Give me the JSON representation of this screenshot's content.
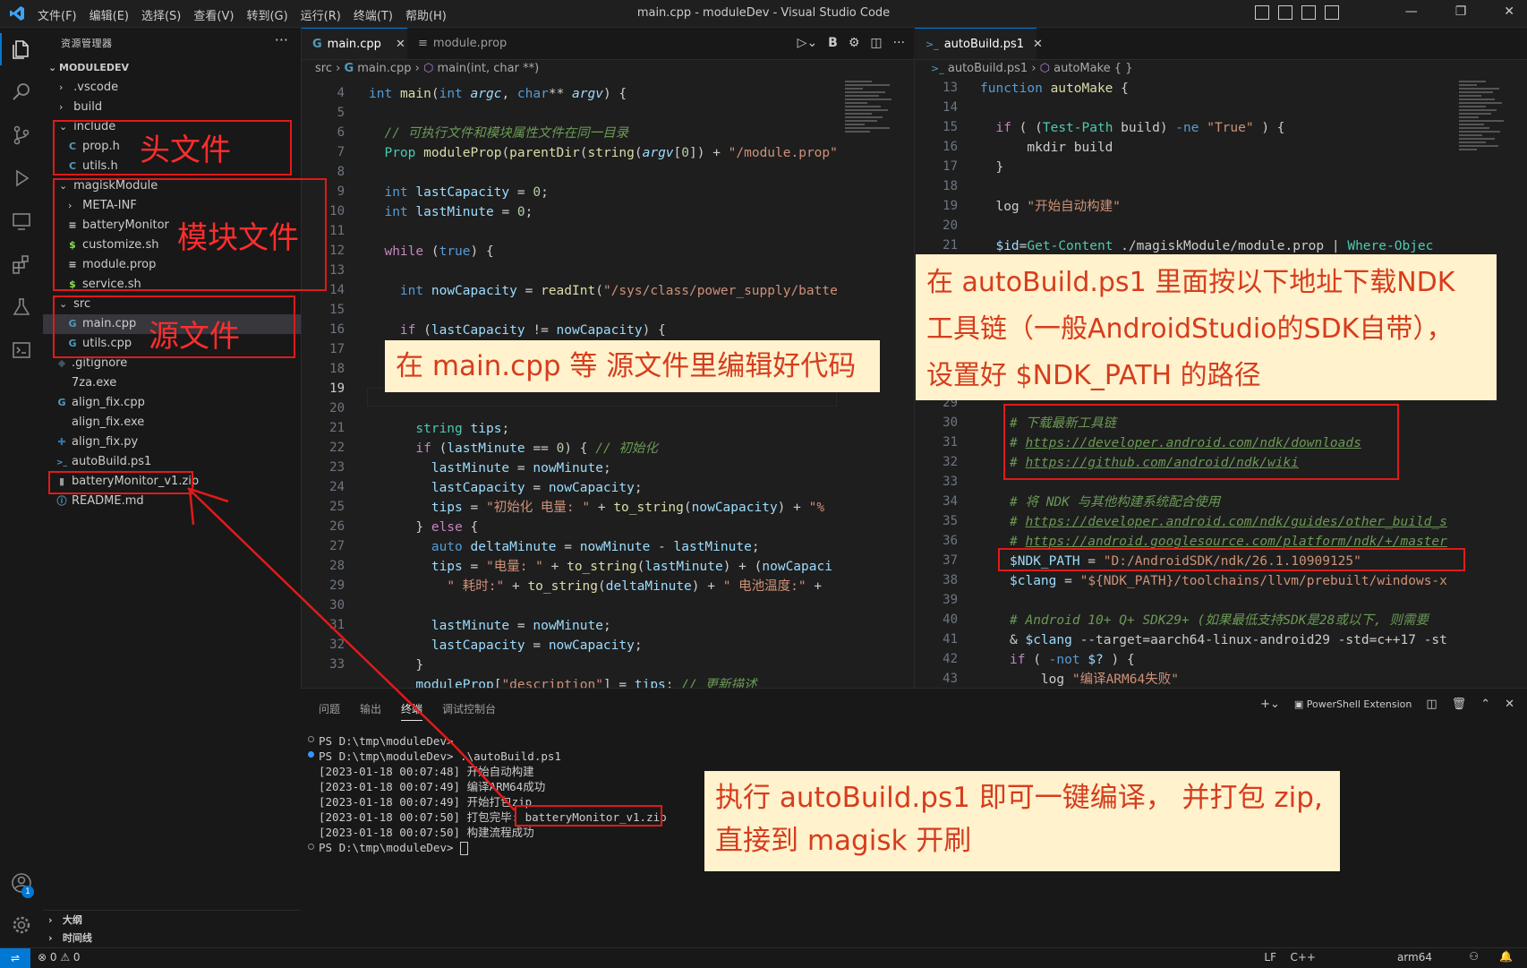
{
  "titlebar": {
    "menu": [
      "文件(F)",
      "编辑(E)",
      "选择(S)",
      "查看(V)",
      "转到(G)",
      "运行(R)",
      "终端(T)",
      "帮助(H)"
    ],
    "title": "main.cpp - moduleDev - Visual Studio Code"
  },
  "sidebar": {
    "header": "资源管理器",
    "root": "MODULEDEV",
    "items": [
      {
        "label": ".vscode",
        "kind": "folder-closed"
      },
      {
        "label": "build",
        "kind": "folder-closed"
      },
      {
        "label": "include",
        "kind": "folder-open"
      },
      {
        "label": "prop.h",
        "kind": "c-header",
        "icon": "C"
      },
      {
        "label": "utils.h",
        "kind": "c-header",
        "icon": "C"
      },
      {
        "label": "magiskModule",
        "kind": "folder-open"
      },
      {
        "label": "META-INF",
        "kind": "folder-closed"
      },
      {
        "label": "batteryMonitor",
        "kind": "file",
        "icon": "≡"
      },
      {
        "label": "customize.sh",
        "kind": "shell",
        "icon": "$"
      },
      {
        "label": "module.prop",
        "kind": "file",
        "icon": "≡"
      },
      {
        "label": "service.sh",
        "kind": "shell",
        "icon": "$"
      },
      {
        "label": "src",
        "kind": "folder-open"
      },
      {
        "label": "main.cpp",
        "kind": "cpp",
        "icon": "G"
      },
      {
        "label": "utils.cpp",
        "kind": "cpp",
        "icon": "G"
      },
      {
        "label": ".gitignore",
        "kind": "git",
        "icon": "◆"
      },
      {
        "label": "7za.exe",
        "kind": "file",
        "icon": ""
      },
      {
        "label": "align_fix.cpp",
        "kind": "cpp",
        "icon": "G"
      },
      {
        "label": "align_fix.exe",
        "kind": "file",
        "icon": ""
      },
      {
        "label": "align_fix.py",
        "kind": "python",
        "icon": "✚"
      },
      {
        "label": "autoBuild.ps1",
        "kind": "powershell",
        "icon": ">_"
      },
      {
        "label": "batteryMonitor_v1.zip",
        "kind": "zip",
        "icon": "▮"
      },
      {
        "label": "README.md",
        "kind": "markdown",
        "icon": "ⓘ"
      }
    ],
    "outline": "大纲",
    "timeline": "时间线"
  },
  "editor_left": {
    "tabs": [
      {
        "label": "main.cpp",
        "icon": "G",
        "active": true
      },
      {
        "label": "module.prop",
        "icon": "≡",
        "active": false
      }
    ],
    "breadcrumb": [
      "src",
      "main.cpp",
      "main(int, char **)"
    ],
    "line_numbers": [
      "4",
      "5",
      "6",
      "7",
      "8",
      "9",
      "10",
      "11",
      "12",
      "13",
      "14",
      "15",
      "16",
      "17",
      "18",
      "19",
      "20",
      "21",
      "22",
      "23",
      "24",
      "25",
      "26",
      "27",
      "28",
      "29",
      "30",
      "31",
      "32",
      "33"
    ],
    "current_line": "19"
  },
  "editor_right": {
    "tab": "autoBuild.ps1",
    "breadcrumb": [
      "autoBuild.ps1",
      "autoMake { }"
    ],
    "line_numbers_top": [
      "13",
      "14",
      "15",
      "16",
      "17",
      "18",
      "19",
      "20",
      "21"
    ],
    "line_numbers_bottom": [
      "29",
      "30",
      "31",
      "32",
      "33",
      "34",
      "35",
      "36",
      "37",
      "38",
      "39",
      "40",
      "41",
      "42",
      "43"
    ]
  },
  "panel": {
    "tabs": [
      "问题",
      "输出",
      "终端",
      "调试控制台"
    ],
    "active_tab": "终端",
    "shell_label": "PowerShell Extension",
    "terminal": [
      "PS D:\\tmp\\moduleDev>",
      "PS D:\\tmp\\moduleDev> .\\autoBuild.ps1",
      "[2023-01-18 00:07:48] 开始自动构建",
      "[2023-01-18 00:07:49] 编译ARM64成功",
      "[2023-01-18 00:07:49] 开始打包zip",
      "[2023-01-18 00:07:50] 打包完毕:",
      "[2023-01-18 00:07:50] 构建流程成功",
      "PS D:\\tmp\\moduleDev> "
    ],
    "zip_name": "batteryMonitor_v1.zip"
  },
  "statusbar": {
    "problems": "⊗ 0 ⚠ 0",
    "eol": "LF",
    "lang": "C++",
    "arch": "arm64"
  },
  "annotations": {
    "include_label": "头文件",
    "module_label": "模块文件",
    "src_label": "源文件",
    "callout_main": "在 main.cpp 等 源文件里编辑好代码",
    "callout_ndk": [
      "在 autoBuild.ps1 里面按以下地址下载NDK",
      "工具链（一般AndroidStudio的SDK自带），",
      "设置好 $NDK_PATH  的路径"
    ],
    "callout_build": [
      "执行 autoBuild.ps1 即可一键编译， 并打包 zip,",
      "直接到 magisk 开刷"
    ]
  },
  "colors": {
    "accent": "#0078d4",
    "annotation_red": "#e01a1a",
    "callout_bg": "#fff2cc",
    "callout_text": "#d63d1e"
  }
}
